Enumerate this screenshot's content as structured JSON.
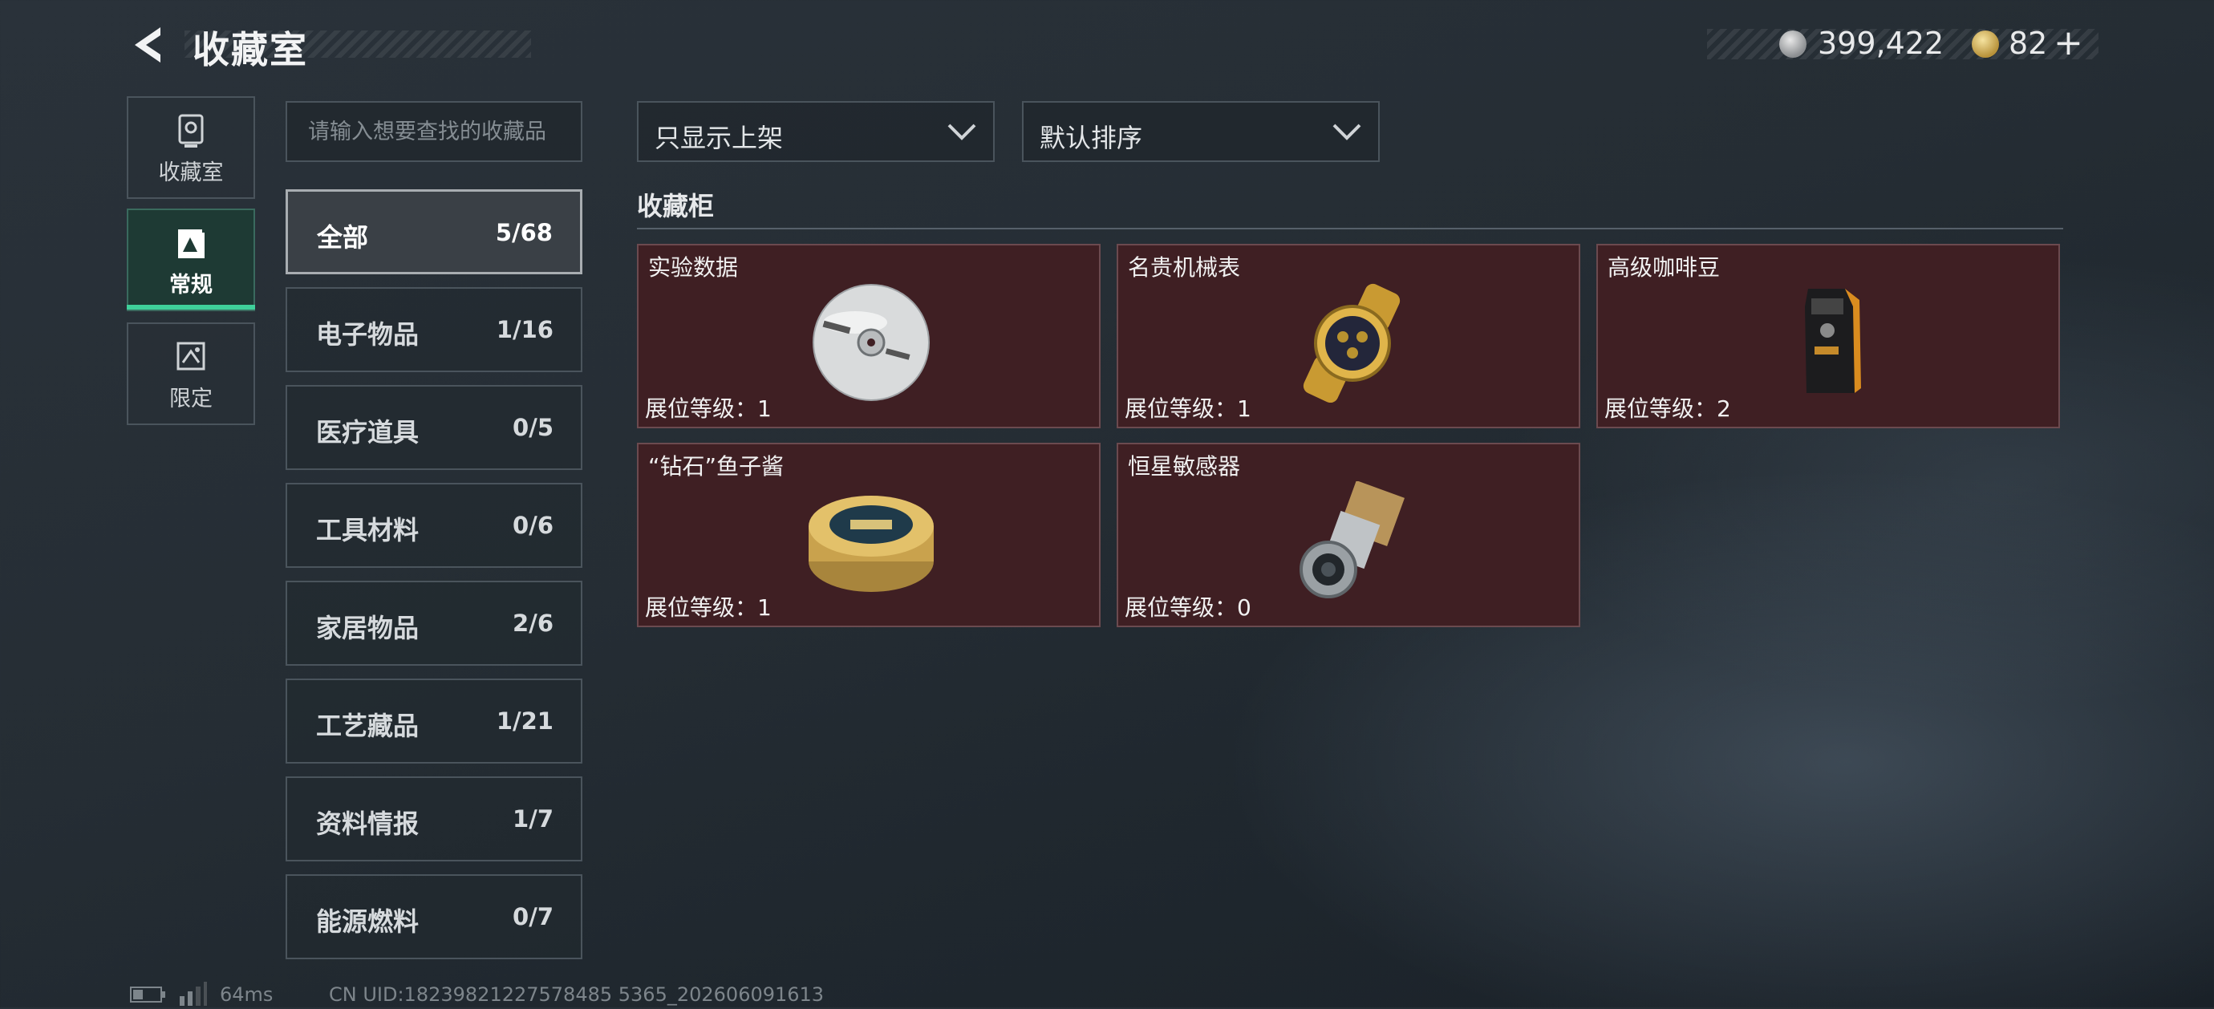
{
  "header": {
    "title": "收藏室",
    "silver_amount": "399,422",
    "gold_amount": "82",
    "plus_label": "+"
  },
  "nav": {
    "items": [
      {
        "label": "收藏室",
        "icon": "trophy-icon"
      },
      {
        "label": "常规",
        "icon": "standard-collection-icon"
      },
      {
        "label": "限定",
        "icon": "limited-collection-icon"
      }
    ],
    "active_index": 1
  },
  "search": {
    "placeholder": "请输入想要查找的收藏品"
  },
  "categories": [
    {
      "name": "全部",
      "count": "5/68"
    },
    {
      "name": "电子物品",
      "count": "1/16"
    },
    {
      "name": "医疗道具",
      "count": "0/5"
    },
    {
      "name": "工具材料",
      "count": "0/6"
    },
    {
      "name": "家居物品",
      "count": "2/6"
    },
    {
      "name": "工艺藏品",
      "count": "1/21"
    },
    {
      "name": "资料情报",
      "count": "1/7"
    },
    {
      "name": "能源燃料",
      "count": "0/7"
    }
  ],
  "filters": {
    "display_filter": "只显示上架",
    "sort_order": "默认排序"
  },
  "cabinet": {
    "title": "收藏柜",
    "items": [
      {
        "name": "实验数据",
        "level": "展位等级：1",
        "icon": "data-disc-icon"
      },
      {
        "name": "名贵机械表",
        "level": "展位等级：1",
        "icon": "gold-watch-icon"
      },
      {
        "name": "高级咖啡豆",
        "level": "展位等级：2",
        "icon": "coffee-bag-icon"
      },
      {
        "name": "“钻石”鱼子酱",
        "level": "展位等级：1",
        "icon": "caviar-tin-icon"
      },
      {
        "name": "恒星敏感器",
        "level": "展位等级：0",
        "icon": "star-sensor-icon"
      }
    ]
  },
  "footer": {
    "ping": "64ms",
    "uid": "CN UID:18239821227578485 5365_202606091613"
  },
  "colors": {
    "accent": "#3fd09a",
    "card_bg": "#3f1f23",
    "nav_active_bg": "#1e3a34"
  }
}
